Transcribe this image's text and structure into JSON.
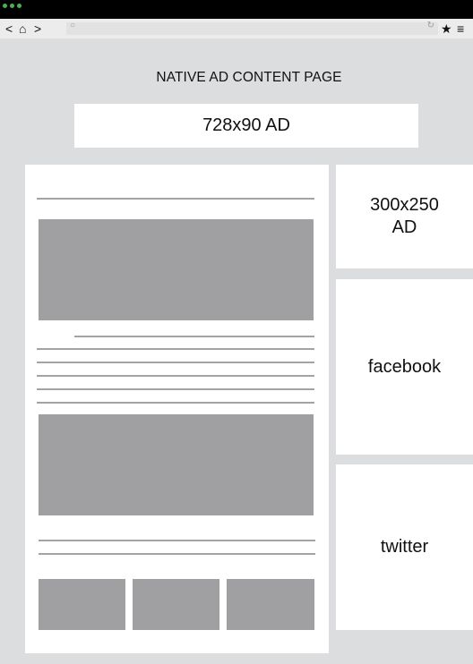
{
  "browser": {
    "back_glyph": "<",
    "home_glyph": "⌂",
    "forward_glyph": ">",
    "search_glyph": "○",
    "reload_glyph": "↻",
    "star_glyph": "★",
    "menu_glyph": "≡",
    "dot_color": "#4caf50"
  },
  "page": {
    "heading": "NATIVE AD CONTENT PAGE",
    "leaderboard_label": "728x90 AD",
    "sidebar": {
      "ad_label": "300x250\nAD",
      "facebook_label": "facebook",
      "twitter_label": "twitter"
    }
  }
}
